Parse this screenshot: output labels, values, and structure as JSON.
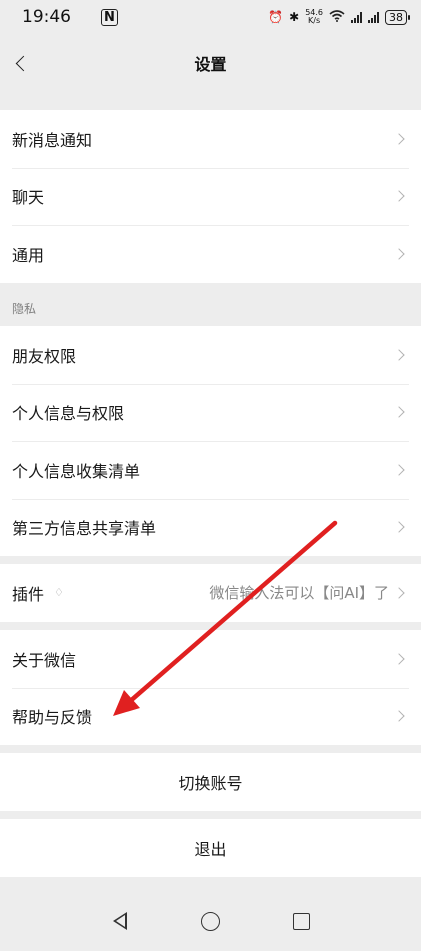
{
  "status_bar": {
    "time": "19:46",
    "nfc": "N",
    "net_speed_value": "54.6",
    "net_speed_unit": "K/s",
    "battery": "38"
  },
  "nav": {
    "title": "设置"
  },
  "group1": [
    {
      "label": "新消息通知"
    },
    {
      "label": "聊天"
    },
    {
      "label": "通用"
    }
  ],
  "privacy_header": "隐私",
  "group2": [
    {
      "label": "朋友权限"
    },
    {
      "label": "个人信息与权限"
    },
    {
      "label": "个人信息收集清单"
    },
    {
      "label": "第三方信息共享清单"
    }
  ],
  "plugins": {
    "label": "插件",
    "hint": "微信输入法可以【问AI】了"
  },
  "group4": [
    {
      "label": "关于微信"
    },
    {
      "label": "帮助与反馈"
    }
  ],
  "switch_account": "切换账号",
  "logout": "退出",
  "annotation_color": "#e02020"
}
